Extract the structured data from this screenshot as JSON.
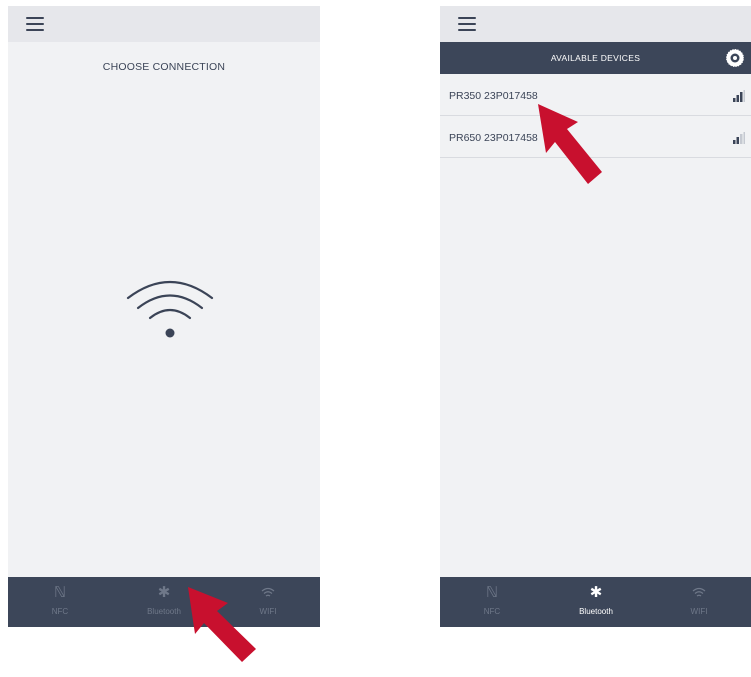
{
  "left_screen": {
    "title": "CHOOSE CONNECTION",
    "nav": [
      {
        "label": "NFC",
        "icon": "nfc-icon"
      },
      {
        "label": "Bluetooth",
        "icon": "bluetooth-icon"
      },
      {
        "label": "WIFI",
        "icon": "wifi-icon"
      }
    ]
  },
  "right_screen": {
    "header_title": "AVAILABLE DEVICES",
    "devices": [
      {
        "name": "PR350 23P017458",
        "signal": "strong"
      },
      {
        "name": "PR650 23P017458",
        "signal": "medium"
      }
    ],
    "nav": [
      {
        "label": "NFC",
        "icon": "nfc-icon"
      },
      {
        "label": "Bluetooth",
        "icon": "bluetooth-icon",
        "active": true
      },
      {
        "label": "WIFI",
        "icon": "wifi-icon"
      }
    ]
  },
  "colors": {
    "nav_bar": "#3c4659",
    "top_bar": "#e6e7eb",
    "screen_bg": "#f1f2f4",
    "pointer_arrow": "#c8102e"
  }
}
